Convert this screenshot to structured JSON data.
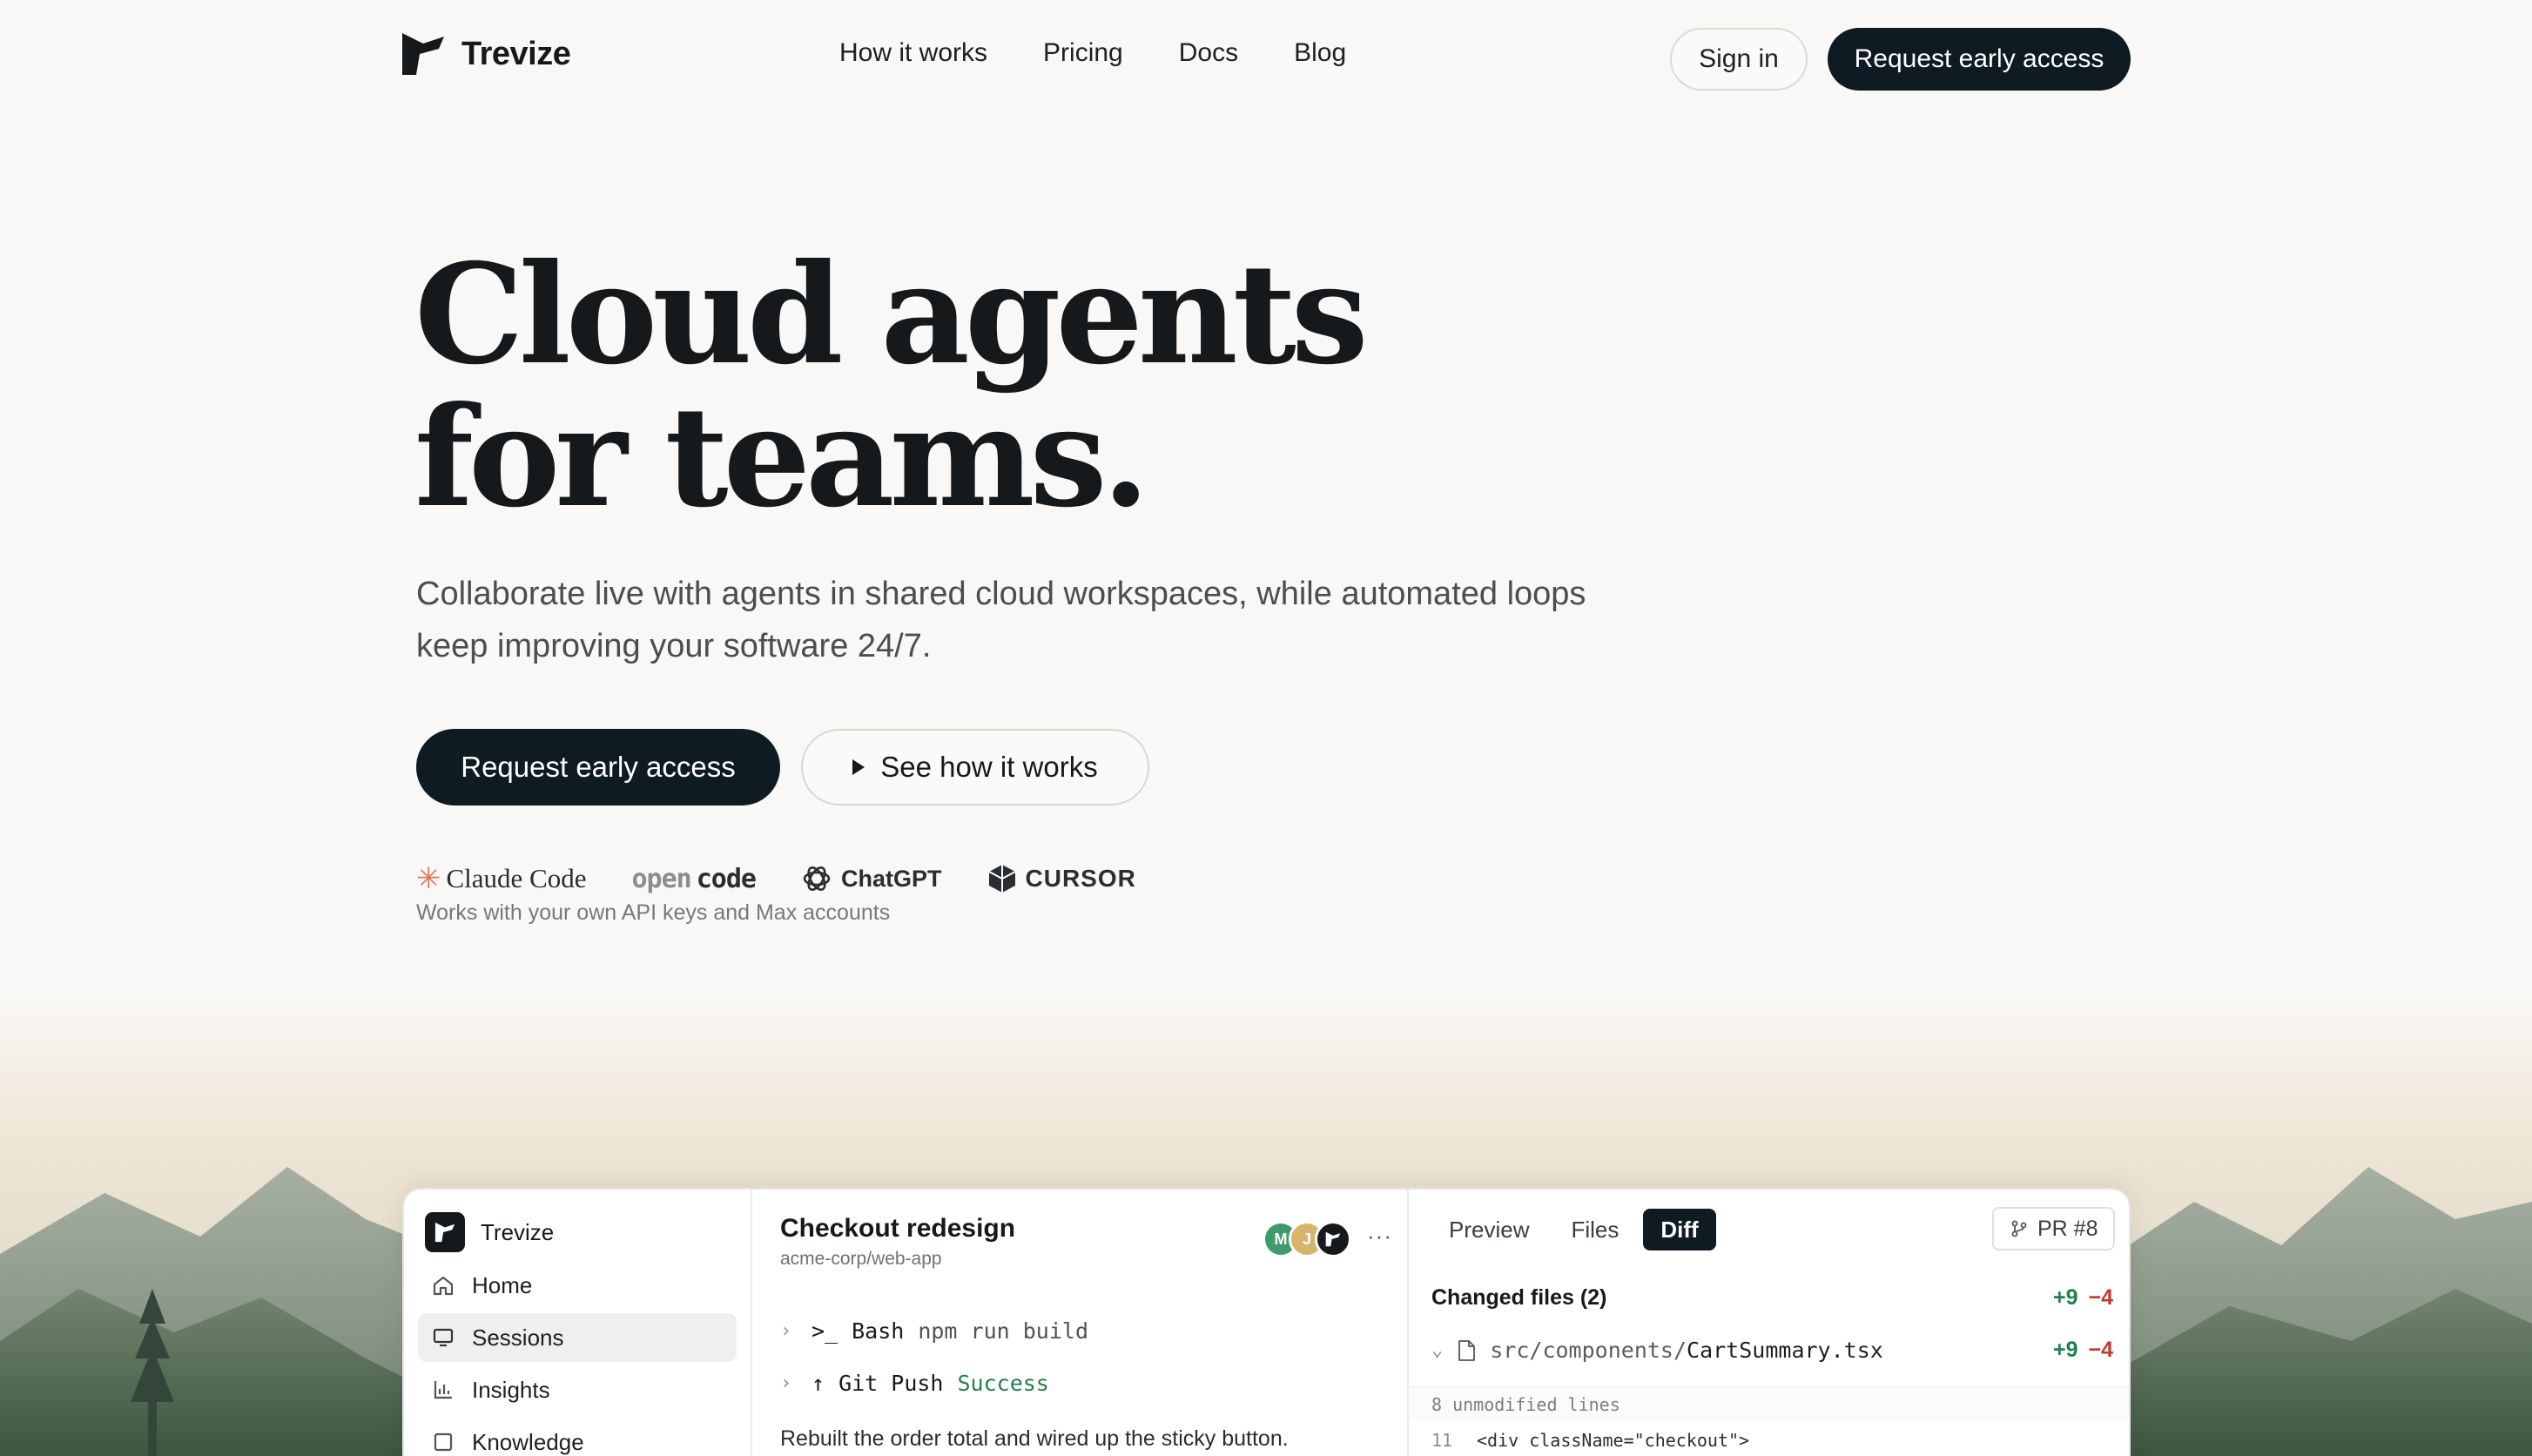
{
  "brand": {
    "name": "Trevize"
  },
  "nav": {
    "links": [
      "How it works",
      "Pricing",
      "Docs",
      "Blog"
    ],
    "sign_in": "Sign in",
    "cta": "Request early access"
  },
  "hero": {
    "title_line1": "Cloud agents",
    "title_line2": "for teams.",
    "subtitle_line1": "Collaborate live with agents in shared cloud workspaces, while automated loops",
    "subtitle_line2": "keep improving your software 24/7.",
    "cta_primary": "Request early access",
    "cta_secondary": "See how it works"
  },
  "partners": {
    "claude": "Claude Code",
    "opencode_a": "open",
    "opencode_b": "code",
    "chatgpt": "ChatGPT",
    "cursor": "CURSOR",
    "caption": "Works with your own API keys and Max accounts"
  },
  "app": {
    "brand": "Trevize",
    "sidebar": [
      {
        "label": "Home",
        "icon": "home-icon",
        "active": false
      },
      {
        "label": "Sessions",
        "icon": "monitor-icon",
        "active": true
      },
      {
        "label": "Insights",
        "icon": "bar-chart-icon",
        "active": false
      },
      {
        "label": "Knowledge",
        "icon": "book-icon",
        "active": false
      }
    ],
    "session": {
      "title": "Checkout redesign",
      "repo": "acme-corp/web-app",
      "avatars": [
        {
          "initial": "M",
          "color": "#3f9a6e"
        },
        {
          "initial": "J",
          "color": "#d6b46b"
        },
        {
          "initial": "",
          "color": "#16191c"
        }
      ],
      "tools": [
        {
          "icon": "terminal-icon",
          "glyph": ">_",
          "name": "Bash",
          "arg": "npm run build",
          "status": ""
        },
        {
          "icon": "arrow-up-icon",
          "glyph": "↑",
          "name": "Git Push",
          "arg": "",
          "status": "Success"
        }
      ],
      "message": "Rebuilt the order total and wired up the sticky button."
    },
    "panel": {
      "tabs": [
        "Preview",
        "Files",
        "Diff"
      ],
      "active_tab": "Diff",
      "pr": "PR #8",
      "changed_title": "Changed files (2)",
      "total_add": "+9",
      "total_del": "−4",
      "file_dir": "src/components/",
      "file_name": "CartSummary.tsx",
      "file_add": "+9",
      "file_del": "−4",
      "unmodified": "8 unmodified lines",
      "line_no": "11",
      "line_code": "<div className=\"checkout\">"
    }
  },
  "colors": {
    "background": "#f9f8f6",
    "primary": "#0f1b22",
    "addition": "#20804d",
    "deletion": "#c33a2c"
  }
}
